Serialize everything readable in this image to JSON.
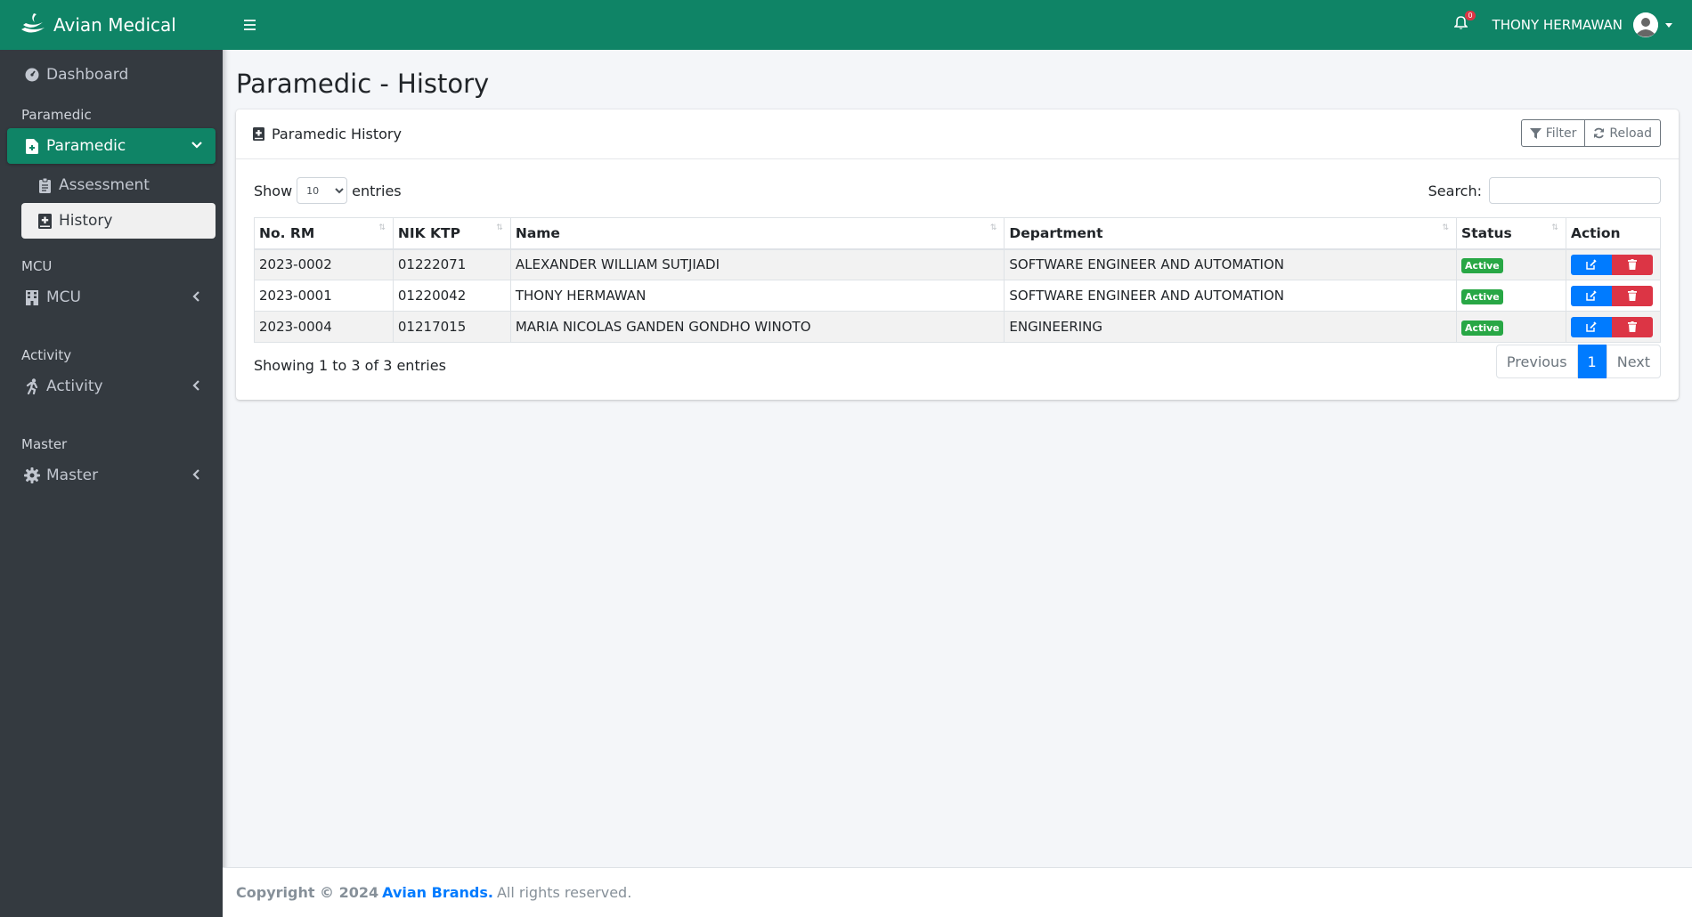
{
  "brand": {
    "name": "Avian Medical"
  },
  "topbar": {
    "notification_count": "0",
    "user_name": "THONY HERMAWAN"
  },
  "sidebar": {
    "dashboard": "Dashboard",
    "sections": {
      "paramedic_header": "Paramedic",
      "paramedic_item": "Paramedic",
      "assessment": "Assessment",
      "history": "History",
      "mcu_header": "MCU",
      "mcu_item": "MCU",
      "activity_header": "Activity",
      "activity_item": "Activity",
      "master_header": "Master",
      "master_item": "Master"
    }
  },
  "page": {
    "title": "Paramedic - History"
  },
  "card": {
    "title": "Paramedic History",
    "filter_label": "Filter",
    "reload_label": "Reload"
  },
  "datatable": {
    "show_label": "Show",
    "entries_label": "entries",
    "page_length": "10",
    "search_label": "Search:",
    "search_value": "",
    "columns": [
      "No. RM",
      "NIK KTP",
      "Name",
      "Department",
      "Status",
      "Action"
    ],
    "rows": [
      {
        "no_rm": "2023-0002",
        "nik": "01222071",
        "name": "ALEXANDER WILLIAM SUTJIADI",
        "department": "SOFTWARE ENGINEER AND AUTOMATION",
        "status": "Active"
      },
      {
        "no_rm": "2023-0001",
        "nik": "01220042",
        "name": "THONY HERMAWAN",
        "department": "SOFTWARE ENGINEER AND AUTOMATION",
        "status": "Active"
      },
      {
        "no_rm": "2023-0004",
        "nik": "01217015",
        "name": "MARIA NICOLAS GANDEN GONDHO WINOTO",
        "department": "ENGINEERING",
        "status": "Active"
      }
    ],
    "info": "Showing 1 to 3 of 3 entries",
    "pagination": {
      "previous": "Previous",
      "current": "1",
      "next": "Next"
    }
  },
  "footer": {
    "prefix": "Copyright © 2024",
    "link": "Avian Brands.",
    "suffix": "All rights reserved."
  },
  "colors": {
    "primary_green": "#0f8466",
    "sidebar_bg": "#343a40",
    "active_badge": "#28a745",
    "edit_blue": "#007bff",
    "delete_red": "#dc3545"
  },
  "icons": {
    "brand": "avian-logo-icon",
    "menu": "hamburger-icon",
    "bell": "bell-icon",
    "avatar": "user-avatar-icon",
    "dashboard": "gauge-icon",
    "paramedic": "file-medical-icon",
    "assessment": "clipboard-icon",
    "history": "book-medical-icon",
    "mcu": "hospital-icon",
    "activity": "running-icon",
    "master": "gear-icon",
    "filter": "filter-icon",
    "reload": "refresh-icon",
    "edit": "edit-icon",
    "delete": "trash-icon"
  }
}
